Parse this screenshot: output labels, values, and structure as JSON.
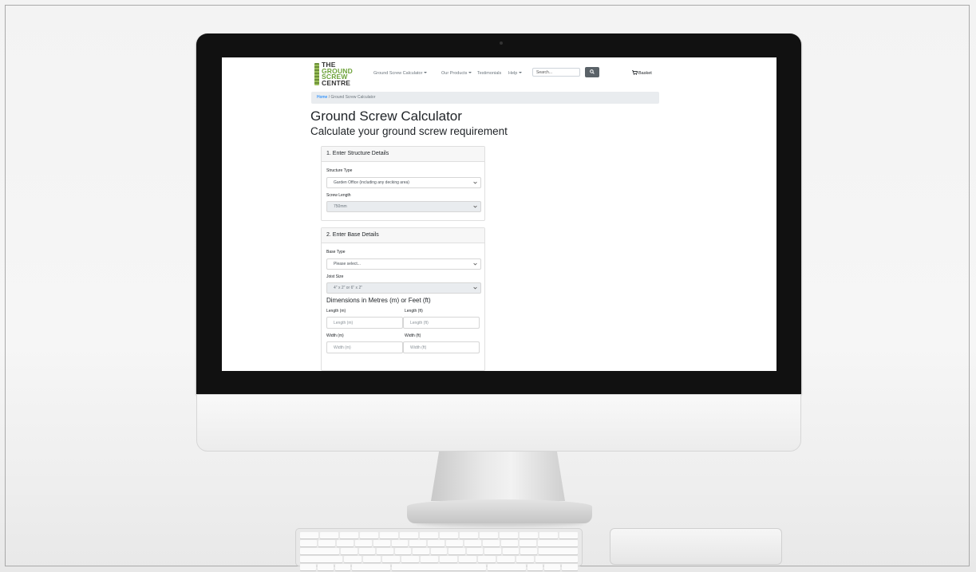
{
  "logo": {
    "line1": "THE",
    "line2": "GROUND",
    "line3": "SCREW",
    "line4": "CENTRE"
  },
  "nav": {
    "items": [
      {
        "label": "Ground Screw Calculator"
      },
      {
        "label": "Our Products"
      },
      {
        "label": "Testimonials"
      },
      {
        "label": "Help"
      }
    ],
    "search_placeholder": "Search...",
    "basket_label": "Basket"
  },
  "breadcrumb": {
    "home": "Home",
    "separator": "/",
    "current": "Ground Screw Calculator"
  },
  "page": {
    "title": "Ground Screw Calculator",
    "subtitle": "Calculate your ground screw requirement"
  },
  "structure_card": {
    "header": "1. Enter Structure Details",
    "structure_type_label": "Structure Type",
    "structure_type_value": "Garden Office (including any decking area)",
    "screw_length_label": "Screw Length",
    "screw_length_value": "750mm"
  },
  "base_card": {
    "header": "2. Enter Base Details",
    "base_type_label": "Base Type",
    "base_type_value": "Please select...",
    "joist_size_label": "Joist Size",
    "joist_size_value": "4\" x 2\" or 6\" x 2\"",
    "dimensions_heading": "Dimensions in Metres (m) or Feet (ft)",
    "length_m_label": "Length (m)",
    "length_m_placeholder": "Length (m)",
    "length_ft_label": "Length (ft)",
    "length_ft_placeholder": "Length (ft)",
    "width_m_label": "Width (m)",
    "width_m_placeholder": "Width (m)",
    "width_ft_label": "Width (ft)",
    "width_ft_placeholder": "Width (ft)"
  },
  "colors": {
    "link": "#007bff",
    "logo_green": "#6ea33a",
    "search_button": "#5a6268",
    "breadcrumb_bg": "#e9ecef"
  }
}
